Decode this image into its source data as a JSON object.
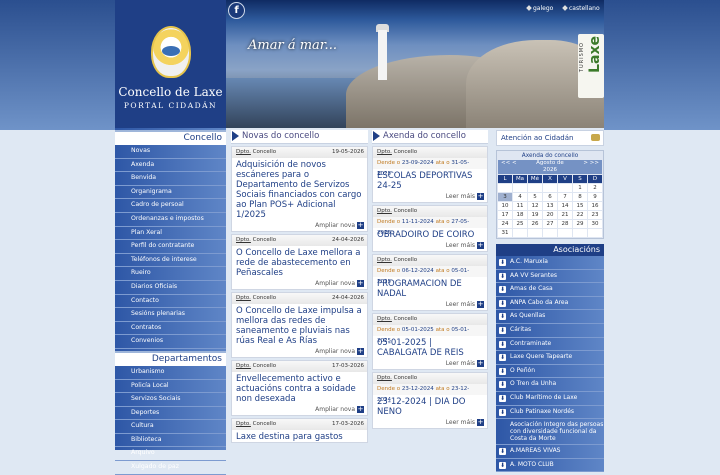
{
  "header": {
    "logo_title": "Concello de Laxe",
    "logo_sub": "PORTAL CIDADÁN",
    "slogan": "Amar á mar...",
    "turismo_small": "TURISMO",
    "turismo_big": "Laxe",
    "facebook": "f",
    "lang_gl": "galego",
    "lang_es": "castellano"
  },
  "nav": {
    "concello_head": "Concello",
    "concello_items": [
      "Novas",
      "Axenda",
      "Benvida",
      "Organigrama",
      "Cadro de persoal",
      "Ordenanzas e impostos",
      "Plan Xeral",
      "Perfil do contratante",
      "Teléfonos de interese",
      "Rueiro",
      "Diarios Oficiais",
      "Contacto",
      "Sesións plenarias",
      "Contratos",
      "Convenios"
    ],
    "dept_head": "Departamentos",
    "dept_items": [
      "Urbanismo",
      "Policía Local",
      "Servizos Sociais",
      "Deportes",
      "Cultura",
      "Biblioteca",
      "Arquivo",
      "Xulgado de paz"
    ]
  },
  "news": {
    "head": "Novas do concello",
    "more": "Ampliar nova",
    "items": [
      {
        "dept": "Dpto.",
        "src": "Concello",
        "date": "19-05-2026",
        "title": "Adquisición de novos escáneres para o Departamento de Servizos Sociais financiados con cargo ao Plan POS+ Adicional 1/2025"
      },
      {
        "dept": "Dpto.",
        "src": "Concello",
        "date": "24-04-2026",
        "title": "O Concello de Laxe mellora a rede de abastecemento en Peñascales"
      },
      {
        "dept": "Dpto.",
        "src": "Concello",
        "date": "24-04-2026",
        "title": "O Concello de Laxe impulsa a mellora das redes de saneamento e pluviais nas rúas Real e As Rías"
      },
      {
        "dept": "Dpto.",
        "src": "Concello",
        "date": "17-03-2026",
        "title": "Envellecemento activo e actuacións contra a soidade non desexada"
      },
      {
        "dept": "Dpto.",
        "src": "Concello",
        "date": "17-03-2026",
        "title": "Laxe destina para gastos"
      }
    ]
  },
  "agenda": {
    "head": "Axenda do concello",
    "more": "Leer máis",
    "from": "Dende o",
    "to": "ata o",
    "items": [
      {
        "dept": "Dpto.",
        "src": "Concello",
        "start": "23-09-2024",
        "end": "31-05-2025",
        "title": "ESCOLAS DEPORTIVAS 24-25"
      },
      {
        "dept": "Dpto.",
        "src": "Concello",
        "start": "11-11-2024",
        "end": "27-05-2025",
        "title": "OBRADOIRO DE COIRO"
      },
      {
        "dept": "Dpto.",
        "src": "Concello",
        "start": "06-12-2024",
        "end": "05-01-2025",
        "title": "PROGRAMACION DE NADAL"
      },
      {
        "dept": "Dpto.",
        "src": "Concello",
        "start": "05-01-2025",
        "end": "05-01-2025",
        "title": "05-01-2025 | CABALGATA DE REIS"
      },
      {
        "dept": "Dpto.",
        "src": "Concello",
        "start": "23-12-2024",
        "end": "23-12-2024",
        "title": "23-12-2024 | DIA DO NENO"
      }
    ]
  },
  "right": {
    "atencion": "Atención ao Cidadán",
    "cal_title": "Axenda do concello",
    "cal_month": "Agosto de",
    "cal_year": "2026",
    "cal_prev2": "<<",
    "cal_prev": "<",
    "cal_next": ">",
    "cal_next2": ">>",
    "weekdays": [
      "L",
      "Ma",
      "Mé",
      "X",
      "V",
      "S",
      "D"
    ],
    "days": [
      "",
      "",
      "",
      "",
      "",
      "1",
      "2",
      "3",
      "4",
      "5",
      "6",
      "7",
      "8",
      "9",
      "10",
      "11",
      "12",
      "13",
      "14",
      "15",
      "16",
      "17",
      "18",
      "19",
      "20",
      "21",
      "22",
      "23",
      "24",
      "25",
      "26",
      "27",
      "28",
      "29",
      "30",
      "31",
      "",
      "",
      "",
      "",
      "",
      ""
    ],
    "asoc_head": "Asociacións",
    "asoc_items": [
      "A.C. Maruxía",
      "AA VV Serantes",
      "Amas de Casa",
      "ANPA Cabo da Area",
      "As Quenllas",
      "Cáritas",
      "Contraminate",
      "Laxe Quere Tapearte",
      "O Peñón",
      "O Tren da Unha",
      "Club Marítimo de Laxe",
      "Club Patinaxe Nordés",
      "Asociación Integro das persoas con diversidade funcional da Costa da Morte",
      "A.MAREAS VIVAS",
      "A. MOTO CLUB"
    ]
  }
}
